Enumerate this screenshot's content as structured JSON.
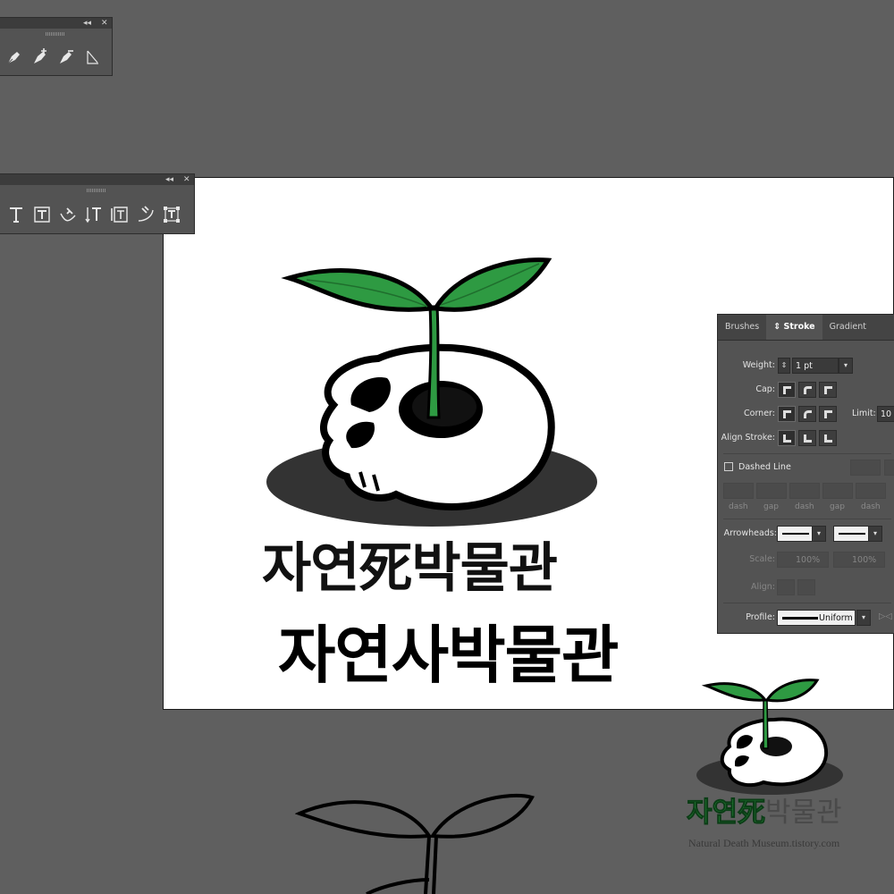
{
  "pen_tools_panel": {
    "tools": [
      {
        "icon": "pen-icon"
      },
      {
        "icon": "add-anchor-point-icon"
      },
      {
        "icon": "delete-anchor-point-icon"
      },
      {
        "icon": "anchor-point-icon"
      }
    ]
  },
  "type_tools_panel": {
    "tools": [
      {
        "icon": "type-icon"
      },
      {
        "icon": "area-type-icon"
      },
      {
        "icon": "type-on-path-icon"
      },
      {
        "icon": "vertical-type-icon"
      },
      {
        "icon": "vertical-area-type-icon"
      },
      {
        "icon": "vertical-type-on-path-icon"
      },
      {
        "icon": "touch-type-icon"
      }
    ]
  },
  "artboard": {
    "title_line1": "자연死박물관",
    "title_line2": "자연사박물관",
    "leaf_color": "#2e9a42",
    "shadow_color": "#333333"
  },
  "stroke_panel": {
    "tabs": [
      "Brushes",
      "Stroke",
      "Gradient"
    ],
    "active_tab": "Stroke",
    "weight_label": "Weight:",
    "weight_value": "1 pt",
    "cap_label": "Cap:",
    "corner_label": "Corner:",
    "limit_label": "Limit:",
    "limit_value": "10",
    "align_stroke_label": "Align Stroke:",
    "dashed_line_label": "Dashed Line",
    "dash_labels": [
      "dash",
      "gap",
      "dash",
      "gap",
      "dash"
    ],
    "arrowheads_label": "Arrowheads:",
    "scale_label": "Scale:",
    "scale_values": [
      "100%",
      "100%"
    ],
    "align_label": "Align:",
    "profile_label": "Profile:",
    "profile_value": "Uniform"
  },
  "watermark": {
    "title_green": "자연死",
    "title_gray": "박물관",
    "caption": "Natural Death Museum.tistory.com"
  }
}
